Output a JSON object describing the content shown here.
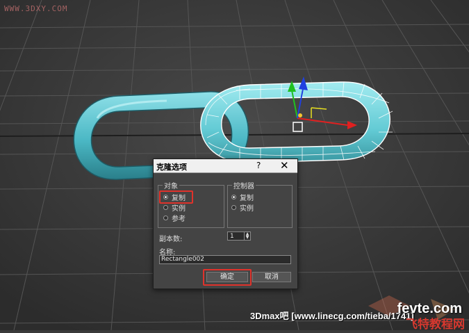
{
  "watermark_top": "WWW.3DXY.COM",
  "dialog": {
    "title": "克隆选项",
    "help_label": "?",
    "close_label": "✕",
    "object_group": {
      "label": "对象",
      "options": [
        "复制",
        "实例",
        "参考"
      ],
      "selected": "复制"
    },
    "controller_group": {
      "label": "控制器",
      "options": [
        "复制",
        "实例"
      ],
      "selected": "复制"
    },
    "copies_label": "副本数:",
    "copies_value": "1",
    "name_label": "名称:",
    "name_value": "Rectangle002",
    "ok_label": "确定",
    "cancel_label": "取消"
  },
  "footer": {
    "text": "3Dmax吧  [www.linecg.com/tieba/1741]",
    "brand": "fevte.com",
    "brand_sub": "飞特教程网"
  },
  "colors": {
    "viewport_bg": "#3a3a3a",
    "torus": "#5cc3cf",
    "highlight": "#e0322b",
    "axis_x": "#e02020",
    "axis_y": "#20c020",
    "axis_z": "#2040e0"
  }
}
